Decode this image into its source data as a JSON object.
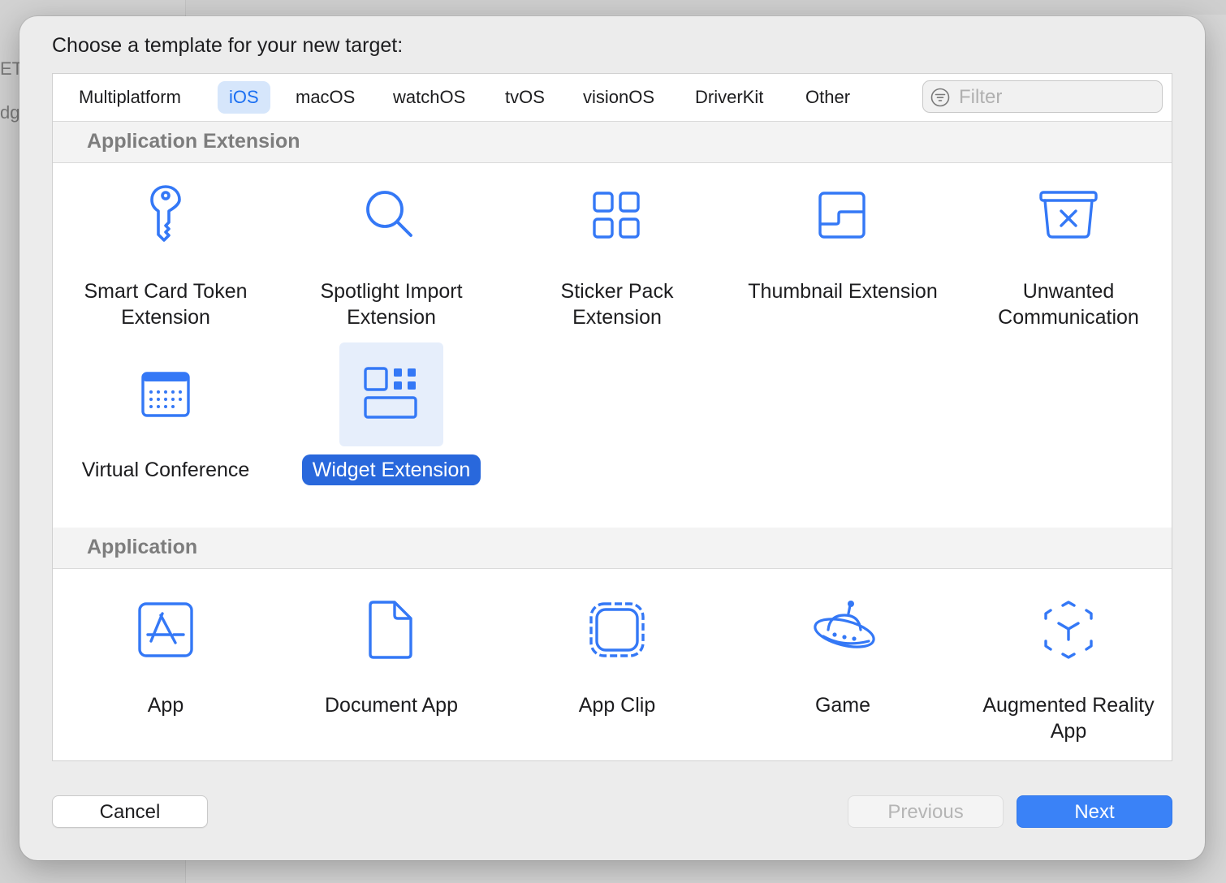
{
  "background": {
    "sidebar_fragment_1": "ET",
    "sidebar_fragment_2": "dg"
  },
  "dialog": {
    "title": "Choose a template for your new target:",
    "platform_tabs": [
      {
        "label": "Multiplatform",
        "selected": false
      },
      {
        "label": "iOS",
        "selected": true
      },
      {
        "label": "macOS",
        "selected": false
      },
      {
        "label": "watchOS",
        "selected": false
      },
      {
        "label": "tvOS",
        "selected": false
      },
      {
        "label": "visionOS",
        "selected": false
      },
      {
        "label": "DriverKit",
        "selected": false
      },
      {
        "label": "Other",
        "selected": false
      }
    ],
    "filter": {
      "placeholder": "Filter",
      "value": ""
    },
    "sections": [
      {
        "title": "Application Extension",
        "items": [
          {
            "label": "Smart Card Token Extension",
            "icon": "key-icon"
          },
          {
            "label": "Spotlight Import Extension",
            "icon": "magnifying-glass-icon"
          },
          {
            "label": "Sticker Pack Extension",
            "icon": "four-squares-icon"
          },
          {
            "label": "Thumbnail Extension",
            "icon": "thumbnail-icon"
          },
          {
            "label": "Unwanted Communication",
            "icon": "trash-bin-x-icon"
          },
          {
            "label": "Virtual Conference",
            "icon": "calendar-icon"
          },
          {
            "label": "Widget Extension",
            "icon": "widget-icon",
            "selected": true
          }
        ]
      },
      {
        "title": "Application",
        "items": [
          {
            "label": "App",
            "icon": "app-store-icon"
          },
          {
            "label": "Document App",
            "icon": "document-icon"
          },
          {
            "label": "App Clip",
            "icon": "app-clip-icon"
          },
          {
            "label": "Game",
            "icon": "ufo-icon"
          },
          {
            "label": "Augmented Reality App",
            "icon": "ar-cube-icon"
          }
        ]
      }
    ],
    "buttons": {
      "cancel": "Cancel",
      "previous": "Previous",
      "next": "Next"
    }
  },
  "colors": {
    "accent": "#3a82f7",
    "selected_label_bg": "#2968dc",
    "icon_blue": "#3478f6",
    "tab_selected_bg": "#d6e6fb"
  }
}
